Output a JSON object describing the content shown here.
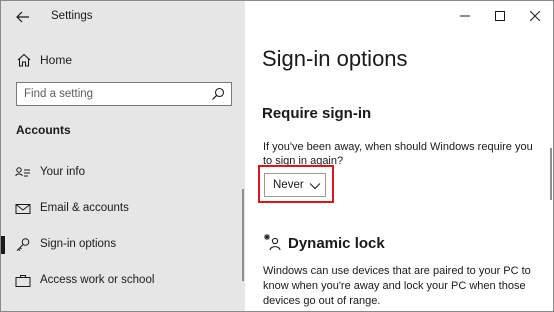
{
  "window": {
    "title": "Settings"
  },
  "sidebar": {
    "home_label": "Home",
    "search_placeholder": "Find a setting",
    "section_title": "Accounts",
    "items": [
      {
        "label": "Your info",
        "icon": "person-card-icon"
      },
      {
        "label": "Email & accounts",
        "icon": "mail-icon"
      },
      {
        "label": "Sign-in options",
        "icon": "key-icon",
        "active": true
      },
      {
        "label": "Access work or school",
        "icon": "briefcase-icon"
      }
    ]
  },
  "main": {
    "page_title": "Sign-in options",
    "require_signin": {
      "title": "Require sign-in",
      "description": "If you've been away, when should Windows require you to sign in again?",
      "dropdown_value": "Never"
    },
    "dynamic_lock": {
      "title": "Dynamic lock",
      "description": "Windows can use devices that are paired to your PC to know when you're away and lock your PC when those devices go out of range."
    }
  },
  "colors": {
    "sidebar_bg": "#e6e6e6",
    "highlight": "#e0121b",
    "text": "#1a1a1a"
  }
}
